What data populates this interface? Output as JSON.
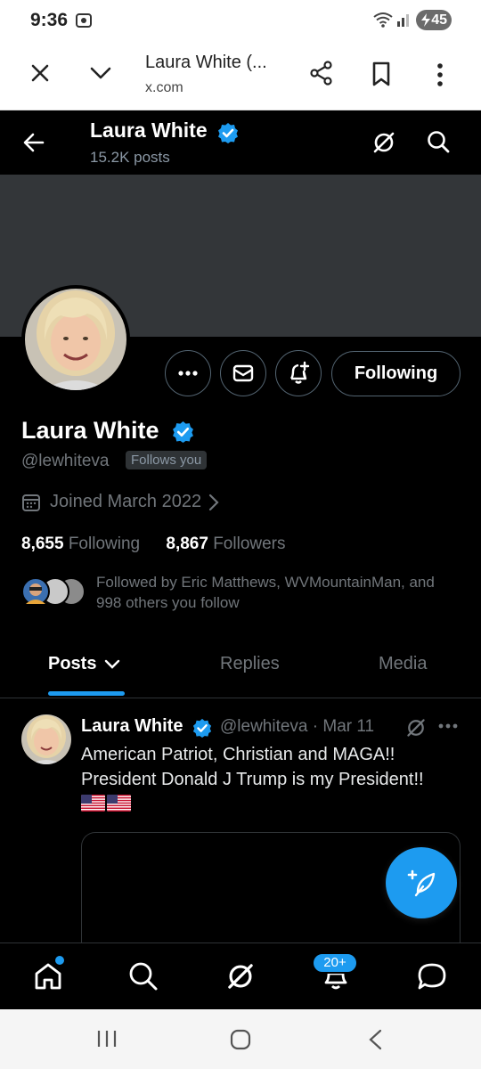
{
  "status_bar": {
    "time": "9:36",
    "battery": "45"
  },
  "browser": {
    "title": "Laura White (...",
    "url": "x.com"
  },
  "profile_header": {
    "name": "Laura White",
    "posts_count": "15.2K posts"
  },
  "profile": {
    "display_name": "Laura White",
    "handle": "@lewhiteva",
    "follows_you": "Follows you",
    "joined": "Joined March 2022",
    "following_count": "8,655",
    "following_label": "Following",
    "followers_count": "8,867",
    "followers_label": "Followers",
    "followed_by": "Followed by Eric Matthews, WVMountainMan, and 998 others you follow",
    "following_button": "Following"
  },
  "tabs": [
    {
      "label": "Posts",
      "active": true
    },
    {
      "label": "Replies",
      "active": false
    },
    {
      "label": "Media",
      "active": false
    }
  ],
  "post": {
    "author": "Laura White",
    "meta": "@lewhiteva · Mar 11",
    "text": "American Patriot, Christian and MAGA!! President Donald J Trump is my President!!"
  },
  "bottom_nav": {
    "notifications_badge": "20+"
  },
  "colors": {
    "accent": "#1d9bf0",
    "background": "#000000",
    "banner": "#333639"
  }
}
